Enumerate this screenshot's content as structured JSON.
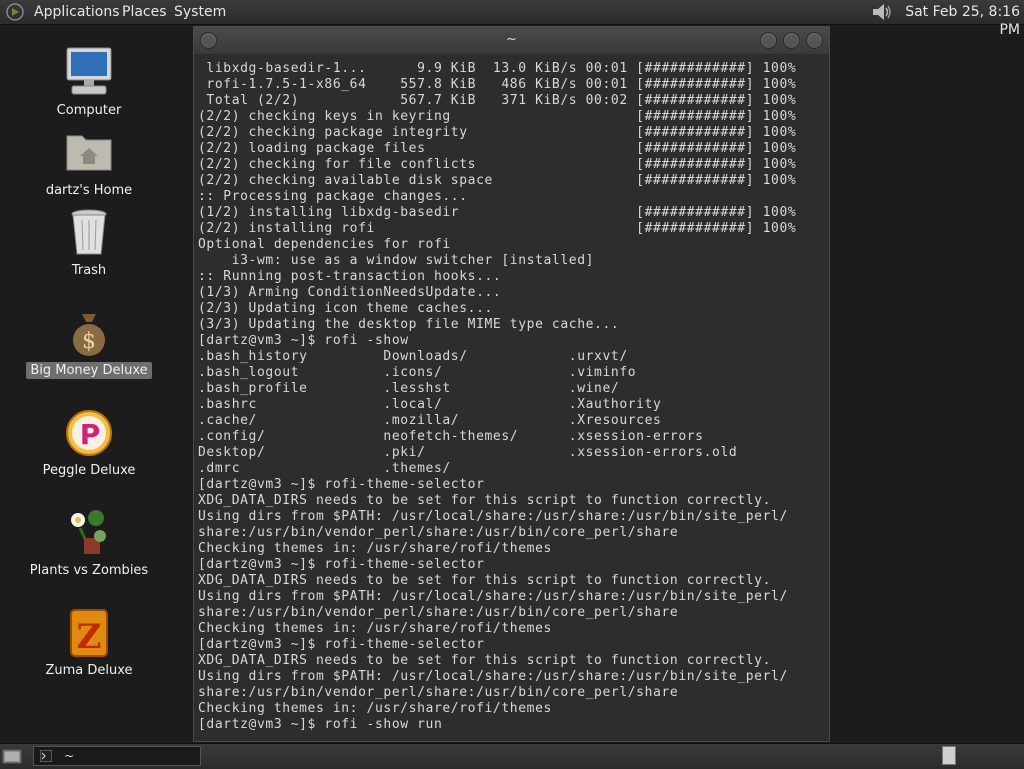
{
  "top_panel": {
    "menus": [
      "Applications",
      "Places",
      "System"
    ],
    "clock": "Sat Feb 25,  8:16 PM",
    "icons": {
      "menu_logo": "gnome-foot-icon",
      "volume": "speaker-icon"
    }
  },
  "desktop": {
    "icons": [
      {
        "label": "Computer",
        "icon": "computer-icon",
        "selected": false
      },
      {
        "label": "dartz's Home",
        "icon": "home-folder-icon",
        "selected": false
      },
      {
        "label": "Trash",
        "icon": "trash-icon",
        "selected": false
      },
      {
        "label": "Big Money Deluxe",
        "icon": "money-bag-icon",
        "selected": true
      },
      {
        "label": "Peggle Deluxe",
        "icon": "peggle-icon",
        "selected": false
      },
      {
        "label": "Plants vs Zombies",
        "icon": "plants-vs-zombies-icon",
        "selected": false
      },
      {
        "label": "Zuma Deluxe",
        "icon": "zuma-icon",
        "selected": false
      }
    ]
  },
  "terminal": {
    "title": "~",
    "lines": [
      " libxdg-basedir-1...      9.9 KiB  13.0 KiB/s 00:01 [############] 100%",
      " rofi-1.7.5-1-x86_64    557.8 KiB   486 KiB/s 00:01 [############] 100%",
      " Total (2/2)            567.7 KiB   371 KiB/s 00:02 [############] 100%",
      "(2/2) checking keys in keyring                      [############] 100%",
      "(2/2) checking package integrity                    [############] 100%",
      "(2/2) loading package files                         [############] 100%",
      "(2/2) checking for file conflicts                   [############] 100%",
      "(2/2) checking available disk space                 [############] 100%",
      ":: Processing package changes...",
      "(1/2) installing libxdg-basedir                     [############] 100%",
      "(2/2) installing rofi                               [############] 100%",
      "Optional dependencies for rofi",
      "    i3-wm: use as a window switcher [installed]",
      ":: Running post-transaction hooks...",
      "(1/3) Arming ConditionNeedsUpdate...",
      "(2/3) Updating icon theme caches...",
      "(3/3) Updating the desktop file MIME type cache...",
      "[dartz@vm3 ~]$ rofi -show",
      ".bash_history         Downloads/            .urxvt/",
      ".bash_logout          .icons/               .viminfo",
      ".bash_profile         .lesshst              .wine/",
      ".bashrc               .local/               .Xauthority",
      ".cache/               .mozilla/             .Xresources",
      ".config/              neofetch-themes/      .xsession-errors",
      "Desktop/              .pki/                 .xsession-errors.old",
      ".dmrc                 .themes/",
      "[dartz@vm3 ~]$ rofi-theme-selector",
      "XDG_DATA_DIRS needs to be set for this script to function correctly.",
      "Using dirs from $PATH: /usr/local/share:/usr/share:/usr/bin/site_perl/",
      "share:/usr/bin/vendor_perl/share:/usr/bin/core_perl/share",
      "Checking themes in: /usr/share/rofi/themes",
      "[dartz@vm3 ~]$ rofi-theme-selector",
      "XDG_DATA_DIRS needs to be set for this script to function correctly.",
      "Using dirs from $PATH: /usr/local/share:/usr/share:/usr/bin/site_perl/",
      "share:/usr/bin/vendor_perl/share:/usr/bin/core_perl/share",
      "Checking themes in: /usr/share/rofi/themes",
      "[dartz@vm3 ~]$ rofi-theme-selector",
      "XDG_DATA_DIRS needs to be set for this script to function correctly.",
      "Using dirs from $PATH: /usr/local/share:/usr/share:/usr/bin/site_perl/",
      "share:/usr/bin/vendor_perl/share:/usr/bin/core_perl/share",
      "Checking themes in: /usr/share/rofi/themes",
      "[dartz@vm3 ~]$ rofi -show run"
    ]
  },
  "bottom_panel": {
    "task_label": "~",
    "icons": {
      "show_desktop": "show-desktop-icon",
      "task": "terminal-icon"
    }
  },
  "colors": {
    "desktop_bg": "#1c1c1c",
    "terminal_bg": "#2d2d2d",
    "terminal_fg": "#d8d8d8",
    "selection": "#6e6e6e"
  }
}
